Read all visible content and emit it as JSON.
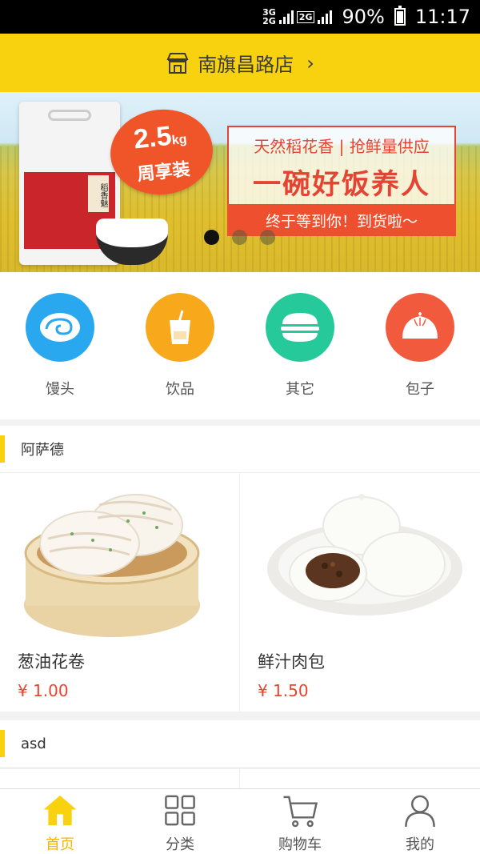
{
  "status_bar": {
    "network_top": "3G",
    "network_bottom": "2G",
    "network_2g": "2G",
    "battery": "90%",
    "time": "11:17"
  },
  "store": {
    "name": "南旗昌路店",
    "chevron": "›"
  },
  "banner": {
    "badge_amount": "2.5",
    "badge_unit": "kg",
    "badge_text": "周享装",
    "promo_line1": "天然稻花香 | 抢鲜量供应",
    "promo_line2": "一碗好饭养人",
    "promo_line3": "终于等到你！到货啦～",
    "bag_brand": "稻香魅",
    "slides": 3,
    "active_slide": 1
  },
  "categories": [
    {
      "label": "馒头",
      "icon": "steamed-bun-roll-icon",
      "color": "#29a8f0"
    },
    {
      "label": "饮品",
      "icon": "drink-cup-icon",
      "color": "#f7a81b"
    },
    {
      "label": "其它",
      "icon": "burger-icon",
      "color": "#26c99a"
    },
    {
      "label": "包子",
      "icon": "baozi-icon",
      "color": "#f25a3e"
    }
  ],
  "sections": [
    {
      "title": "阿萨德",
      "products": [
        {
          "name": "葱油花卷",
          "price": "¥ 1.00"
        },
        {
          "name": "鲜汁肉包",
          "price": "¥ 1.50"
        }
      ]
    },
    {
      "title": "asd"
    }
  ],
  "tabs": [
    {
      "label": "首页",
      "icon": "home-icon",
      "active": true
    },
    {
      "label": "分类",
      "icon": "grid-icon",
      "active": false
    },
    {
      "label": "购物车",
      "icon": "cart-icon",
      "active": false
    },
    {
      "label": "我的",
      "icon": "user-icon",
      "active": false
    }
  ],
  "colors": {
    "brand_yellow": "#f8d20f",
    "price_red": "#e8432e",
    "active_tab": "#f2b600"
  }
}
